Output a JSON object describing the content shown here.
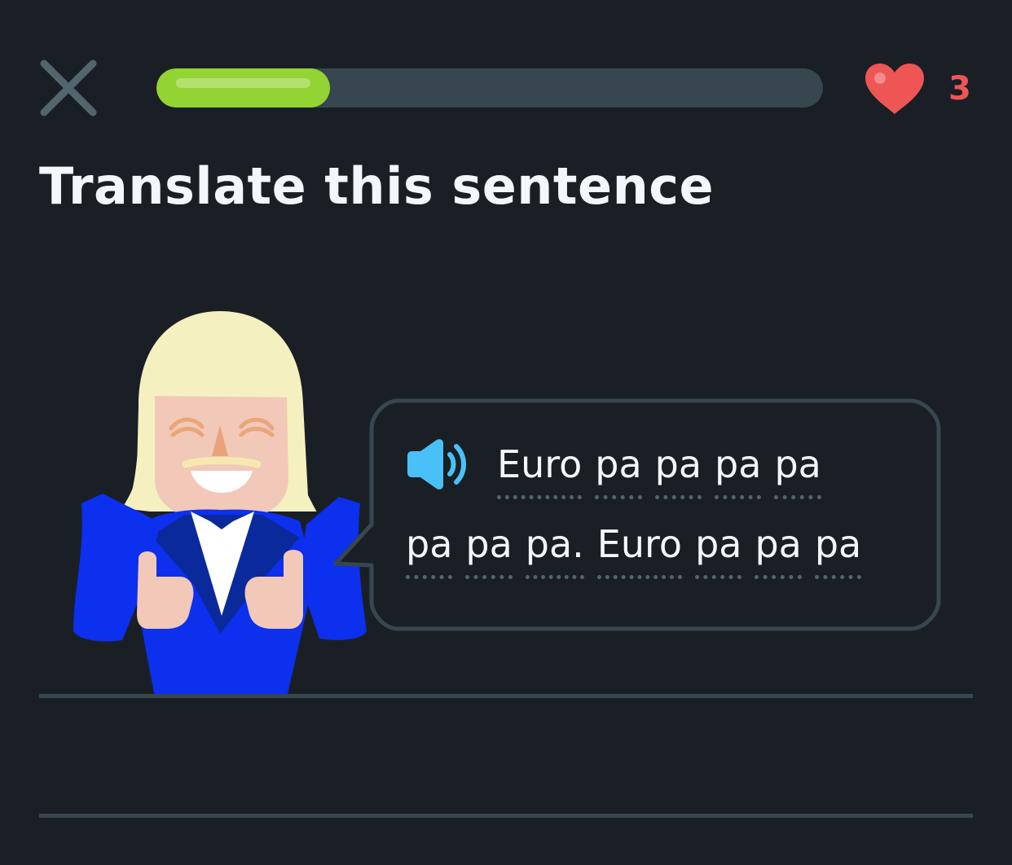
{
  "header": {
    "close_icon": "close-icon",
    "progress": {
      "fraction": 0.26,
      "color": "#93d333",
      "track_color": "#37464f"
    },
    "hearts": {
      "icon": "heart-icon",
      "count": "3",
      "color": "#ee5555"
    }
  },
  "challenge": {
    "title": "Translate this sentence",
    "speaker_icon": "speaker-icon",
    "speaker_color": "#49c0f8",
    "lines": [
      [
        "Euro",
        "pa",
        "pa",
        "pa",
        "pa"
      ],
      [
        "pa",
        "pa",
        "pa.",
        "Euro",
        "pa",
        "pa",
        "pa"
      ]
    ]
  },
  "theme": {
    "background": "#1a1f26",
    "text": "#f1f7fb",
    "divider": "#37464f"
  }
}
